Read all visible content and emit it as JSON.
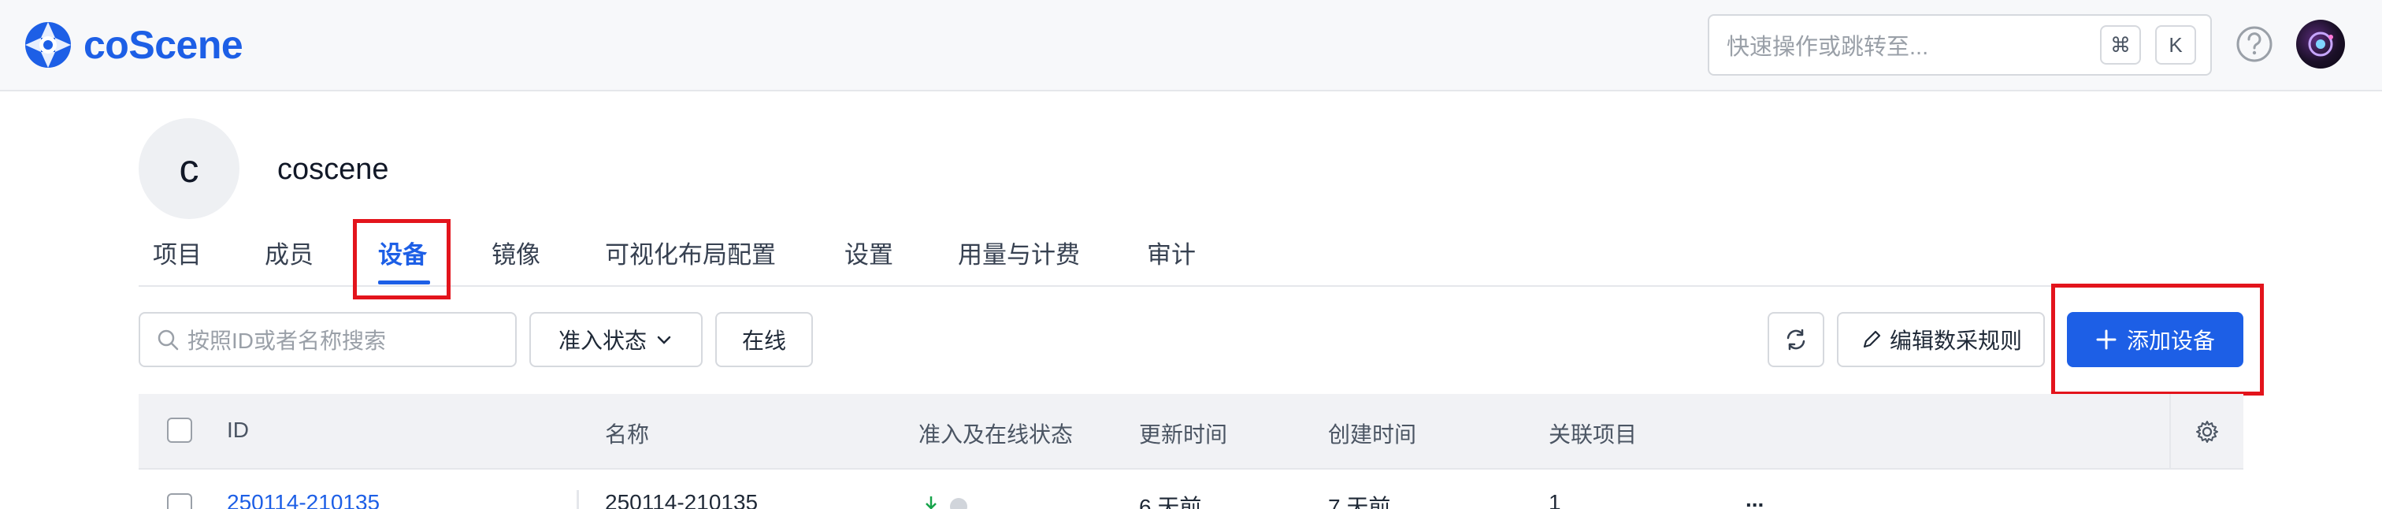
{
  "brand": {
    "name": "coScene",
    "color": "#1d5fe6"
  },
  "topbar": {
    "search_placeholder": "快速操作或跳转至...",
    "shortcut_keys": [
      "⌘",
      "K"
    ],
    "help_icon": "question-circle-icon",
    "avatar_icon": "user-avatar"
  },
  "org": {
    "initial": "c",
    "name": "coscene"
  },
  "tabs": [
    {
      "label": "项目"
    },
    {
      "label": "成员"
    },
    {
      "label": "设备",
      "active": true
    },
    {
      "label": "镜像"
    },
    {
      "label": "可视化布局配置"
    },
    {
      "label": "设置"
    },
    {
      "label": "用量与计费"
    },
    {
      "label": "审计"
    }
  ],
  "toolbar": {
    "search_placeholder": "按照ID或者名称搜索",
    "access_filter": "准入状态",
    "online_filter": "在线",
    "refresh_icon": "refresh-icon",
    "edit_rules": "编辑数采规则",
    "add_device": "添加设备"
  },
  "table": {
    "columns": [
      "ID",
      "名称",
      "准入及在线状态",
      "更新时间",
      "创建时间",
      "关联项目"
    ],
    "rows": [
      {
        "id": "250114-210135",
        "name": "250114-210135",
        "updated": "6 天前",
        "created": "7 天前",
        "projects": "1",
        "more": "..."
      }
    ]
  },
  "highlight_color": "#e3141c"
}
